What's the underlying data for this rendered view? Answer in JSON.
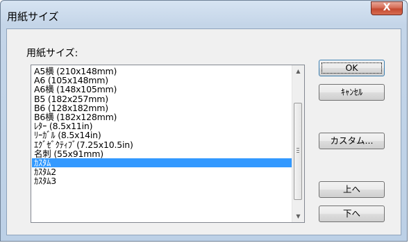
{
  "window": {
    "title": "用紙サイズ",
    "close_label": "X"
  },
  "list": {
    "label": "用紙サイズ:",
    "items": [
      "A5横 (210x148mm)",
      "A6 (105x148mm)",
      "A6横 (148x105mm)",
      "B5 (182x257mm)",
      "B6 (128x182mm)",
      "B6横 (182x128mm)",
      "ﾚﾀｰ (8.5x11in)",
      "ﾘｰｶﾞﾙ (8.5x14in)",
      "ｴｸﾞｾﾞｸﾃｨﾌﾞ(7.25x10.5in)",
      "名刺 (55x91mm)",
      "ｶｽﾀﾑ",
      "ｶｽﾀﾑ2",
      "ｶｽﾀﾑ3"
    ],
    "selected": "ｶｽﾀﾑ"
  },
  "buttons": {
    "ok": "OK",
    "cancel": "ｷｬﾝｾﾙ",
    "custom": "カスタム...",
    "up": "上へ",
    "down": "下へ"
  }
}
